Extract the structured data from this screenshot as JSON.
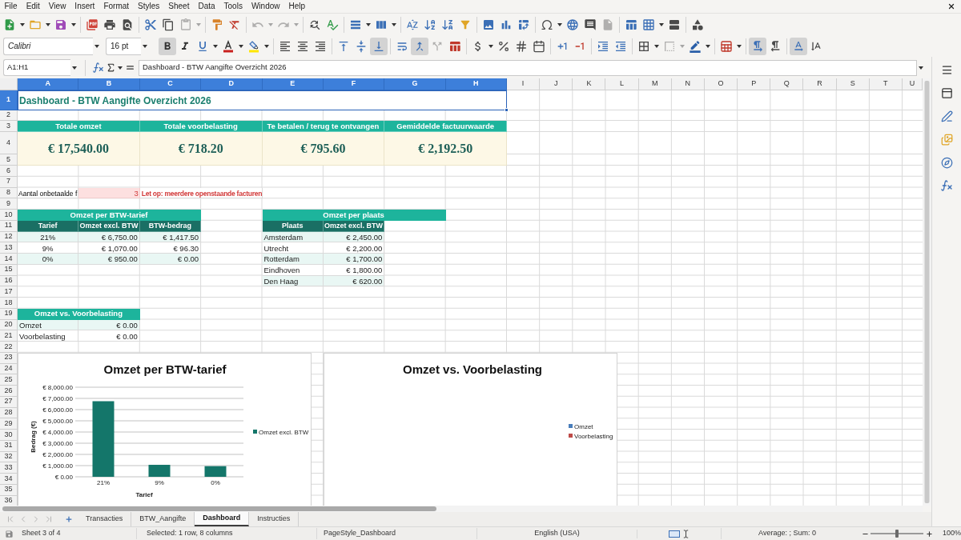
{
  "menu": [
    "File",
    "Edit",
    "View",
    "Insert",
    "Format",
    "Styles",
    "Sheet",
    "Data",
    "Tools",
    "Window",
    "Help"
  ],
  "standard_toolbar": {
    "paste_disabled": true,
    "undo_disabled": true,
    "redo_disabled": true,
    "header_footer_disabled": true
  },
  "formatting_toolbar": {
    "font_name": "Calibri",
    "font_size": "16 pt",
    "bold": true,
    "italic": false,
    "underline": false,
    "align_left": false,
    "align_center": false,
    "align_right": false,
    "align_top": false,
    "align_middle": false,
    "align_bottom": true,
    "wrap_text": false,
    "merge_and_center": true,
    "unmerge_disabled": true,
    "border_style_disabled": true,
    "left_to_right": true,
    "right_to_left": false,
    "text_left_to_right": true,
    "text_top_to_bottom": false
  },
  "formula_bar": {
    "name_box": "A1:H1",
    "content": "Dashboard - BTW Aangifte Overzicht 2026"
  },
  "sheet": {
    "columns": [
      {
        "label": "A",
        "selected": true
      },
      {
        "label": "B",
        "selected": true
      },
      {
        "label": "C",
        "selected": true
      },
      {
        "label": "D",
        "selected": true
      },
      {
        "label": "E",
        "selected": true
      },
      {
        "label": "F",
        "selected": true
      },
      {
        "label": "G",
        "selected": true
      },
      {
        "label": "H",
        "selected": true
      },
      {
        "label": "I",
        "selected": false
      },
      {
        "label": "J",
        "selected": false
      },
      {
        "label": "K",
        "selected": false
      },
      {
        "label": "L",
        "selected": false
      },
      {
        "label": "M",
        "selected": false
      },
      {
        "label": "N",
        "selected": false
      },
      {
        "label": "O",
        "selected": false
      },
      {
        "label": "P",
        "selected": false
      },
      {
        "label": "Q",
        "selected": false
      },
      {
        "label": "R",
        "selected": false
      },
      {
        "label": "S",
        "selected": false
      },
      {
        "label": "T",
        "selected": false
      },
      {
        "label": "U",
        "selected": false
      }
    ],
    "rows": [
      {
        "label": "1",
        "selected": true
      },
      {
        "label": "2",
        "selected": false
      },
      {
        "label": "3",
        "selected": false
      },
      {
        "label": "4",
        "selected": false
      },
      {
        "label": "5",
        "selected": false
      },
      {
        "label": "6",
        "selected": false
      },
      {
        "label": "7",
        "selected": false
      },
      {
        "label": "8",
        "selected": false
      },
      {
        "label": "9",
        "selected": false
      },
      {
        "label": "10",
        "selected": false
      },
      {
        "label": "11",
        "selected": false
      },
      {
        "label": "12",
        "selected": false
      },
      {
        "label": "13",
        "selected": false
      },
      {
        "label": "14",
        "selected": false
      },
      {
        "label": "15",
        "selected": false
      },
      {
        "label": "16",
        "selected": false
      },
      {
        "label": "17",
        "selected": false
      },
      {
        "label": "18",
        "selected": false
      },
      {
        "label": "19",
        "selected": false
      },
      {
        "label": "20",
        "selected": false
      },
      {
        "label": "21",
        "selected": false
      },
      {
        "label": "22",
        "selected": false
      },
      {
        "label": "23",
        "selected": false
      },
      {
        "label": "24",
        "selected": false
      },
      {
        "label": "25",
        "selected": false
      },
      {
        "label": "26",
        "selected": false
      },
      {
        "label": "27",
        "selected": false
      },
      {
        "label": "28",
        "selected": false
      },
      {
        "label": "29",
        "selected": false
      },
      {
        "label": "30",
        "selected": false
      },
      {
        "label": "31",
        "selected": false
      },
      {
        "label": "32",
        "selected": false
      },
      {
        "label": "33",
        "selected": false
      },
      {
        "label": "34",
        "selected": false
      },
      {
        "label": "35",
        "selected": false
      },
      {
        "label": "36",
        "selected": false
      }
    ],
    "title": "Dashboard - BTW Aangifte Overzicht 2026",
    "kpis": [
      {
        "label": "Totale omzet",
        "value": "€ 17,540.00"
      },
      {
        "label": "Totale voorbelasting",
        "value": "€ 718.20"
      },
      {
        "label": "Te betalen / terug te ontvangen",
        "value": "€ 795.60"
      },
      {
        "label": "Gemiddelde factuurwaarde",
        "value": "€ 2,192.50"
      }
    ],
    "alert": {
      "label": "Aantal onbetaalde f",
      "count": "3",
      "message": "Let op: meerdere openstaande facturen"
    },
    "rate_table": {
      "title": "Omzet per BTW-tarief",
      "columns": [
        "Tarief",
        "Omzet excl. BTW",
        "BTW-bedrag"
      ],
      "rows": [
        [
          "21%",
          "€ 6,750.00",
          "€ 1,417.50"
        ],
        [
          "9%",
          "€ 1,070.00",
          "€ 96.30"
        ],
        [
          "0%",
          "€ 950.00",
          "€ 0.00"
        ]
      ]
    },
    "city_table": {
      "title": "Omzet per plaats",
      "columns": [
        "Plaats",
        "Omzet excl. BTW"
      ],
      "rows": [
        [
          "Amsterdam",
          "€ 2,450.00"
        ],
        [
          "Utrecht",
          "€ 2,200.00"
        ],
        [
          "Rotterdam",
          "€ 1,700.00"
        ],
        [
          "Eindhoven",
          "€ 1,800.00"
        ],
        [
          "Den Haag",
          "€ 620.00"
        ]
      ]
    },
    "comparison_table": {
      "title": "Omzet vs. Voorbelasting",
      "rows": [
        [
          "Omzet",
          "€ 0.00"
        ],
        [
          "Voorbelasting",
          "€ 0.00"
        ]
      ]
    },
    "charts": [
      {
        "kind": "chart",
        "chart_data": {
          "type": "bar",
          "title": "Omzet per BTW-tarief",
          "xlabel": "Tarief",
          "ylabel": "Bedrag (€)",
          "categories": [
            "21%",
            "9%",
            "0%"
          ],
          "series": [
            {
              "name": "Omzet excl. BTW",
              "color": "#14766a",
              "values": [
                6750,
                1070,
                950
              ]
            }
          ],
          "ylim": [
            0,
            8000
          ],
          "yticks": [
            {
              "value": 0,
              "label": "€ 0.00"
            },
            {
              "value": 1000,
              "label": "€ 1,000.00"
            },
            {
              "value": 2000,
              "label": "€ 2,000.00"
            },
            {
              "value": 3000,
              "label": "€ 3,000.00"
            },
            {
              "value": 4000,
              "label": "€ 4,000.00"
            },
            {
              "value": 5000,
              "label": "€ 5,000.00"
            },
            {
              "value": 6000,
              "label": "€ 6,000.00"
            },
            {
              "value": 7000,
              "label": "€ 7,000.00"
            },
            {
              "value": 8000,
              "label": "€ 8,000.00"
            }
          ],
          "grid": true
        }
      },
      {
        "kind": "empty",
        "title": "Omzet vs. Voorbelasting",
        "legend": [
          {
            "label": "Omzet",
            "color": "#4a7ebb"
          },
          {
            "label": "Voorbelasting",
            "color": "#be4b48"
          }
        ]
      }
    ]
  },
  "sheet_tabs": [
    {
      "label": "Transacties",
      "selected": false
    },
    {
      "label": "BTW_Aangifte",
      "selected": false
    },
    {
      "label": "Dashboard",
      "selected": true
    },
    {
      "label": "Instructies",
      "selected": false
    }
  ],
  "status_bar": {
    "sheet": "Sheet 3 of 4",
    "selection": "Selected: 1 row, 8 columns",
    "page_style": "PageStyle_Dashboard",
    "language": "English (USA)",
    "summary": "Average: ; Sum: 0",
    "zoom": {
      "level": 0.5,
      "reading": "100%"
    }
  }
}
